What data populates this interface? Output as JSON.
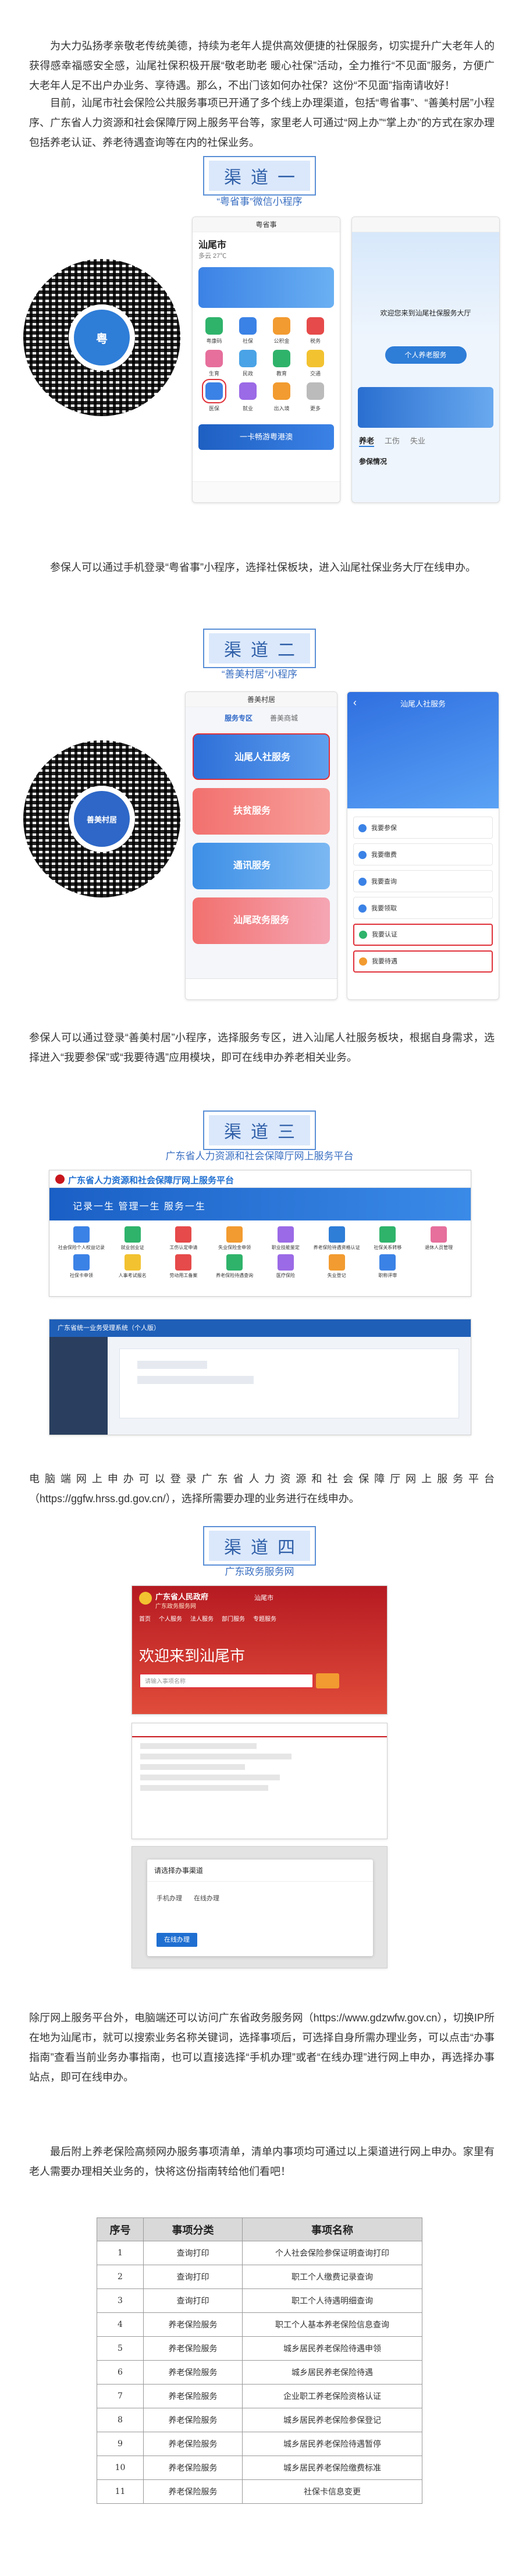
{
  "intro": {
    "p1": "为大力弘扬孝亲敬老传统美德，持续为老年人提供高效便捷的社保服务，切实提升广大老年人的获得感幸福感安全感，汕尾社保积极开展“敬老助老 暖心社保”活动，全力推行“不见面”服务，方便广大老年人足不出户办业务、享待遇。那么，不出门该如何办社保？这份“不见面”指南请收好！",
    "p2": "目前，汕尾市社会保险公共服务事项已开通了多个线上办理渠道，包括“粤省事”、“善美村居”小程序、广东省人力资源和社会保障厅网上服务平台等，家里老人可通过“网上办”“掌上办”的方式在家办理包括养老认证、养老待遇查询等在内的社保业务。"
  },
  "channels": [
    {
      "badge": "渠道一",
      "subtitle": "“粤省事”微信小程序",
      "qr_logo": "粤",
      "phone1": {
        "title": "粤省事",
        "city": "汕尾市",
        "weather": "多云 27℃",
        "icons": [
          "粤康码",
          "社保",
          "公积金",
          "税务",
          "生育",
          "民政",
          "教育",
          "交通",
          "医保",
          "就业",
          "出入境",
          "更多"
        ],
        "banner": "一卡畅游粤港澳"
      },
      "phone2": {
        "welcome": "欢迎您来到汕尾社保服务大厅",
        "btn": "个人养老服务",
        "tabs": [
          "养老",
          "工伤",
          "失业"
        ],
        "section": "参保情况"
      }
    },
    {
      "badge": "渠道二",
      "subtitle": "“善美村居”小程序",
      "qr_logo": "善美村居",
      "phone1": {
        "title": "善美村居",
        "tabs": [
          "服务专区",
          "善美商城"
        ],
        "cards": [
          "汕尾人社服务",
          "扶贫服务",
          "通讯服务",
          "汕尾政务服务"
        ]
      },
      "phone2": {
        "title": "汕尾人社服务",
        "items": [
          "我要参保",
          "我要缴费",
          "我要查询",
          "我要领取",
          "我要认证",
          "我要待遇"
        ]
      }
    },
    {
      "badge": "渠道三",
      "subtitle": "广东省人力资源和社会保障厅网上服务平台",
      "site_title": "广东省人力资源和社会保障厅网上服务平台",
      "slogan": "记录一生  管理一生  服务一生",
      "services": [
        "社会保险个人权益记录",
        "就业创业证",
        "工伤认定申请",
        "失业保险金申领",
        "职业技能鉴定",
        "养老保险待遇资格认证",
        "社保关系转移",
        "退休人员管理",
        "社保卡申领",
        "人事考试报名",
        "劳动用工备案",
        "养老保险待遇查询",
        "医疗保险",
        "失业登记",
        "职称评审"
      ],
      "panel_title": "广东省统一业务受理系统（个人版）"
    },
    {
      "badge": "渠道四",
      "subtitle": "广东政务服务网",
      "site_name": "广东省人民政府",
      "portal": "广东政务服务网",
      "location": "汕尾市",
      "welcome": "欢迎来到汕尾市",
      "nav": [
        "首页",
        "个人服务",
        "法人服务",
        "部门服务",
        "专题服务"
      ],
      "search_placeholder": "请输入事项名称",
      "dialog_title": "请选择办事渠道",
      "dialog_options": [
        "手机办理",
        "在线办理"
      ],
      "dialog_button": "在线办理"
    }
  ],
  "captions": {
    "c1": "参保人可以通过手机登录“粤省事”小程序，选择社保板块，进入汕尾社保业务大厅在线申办。",
    "c2": "参保人可以通过登录“善美村居”小程序，选择服务专区，进入汕尾人社服务板块，根据自身需求，选择进入“我要参保”或“我要待遇”应用模块，即可在线申办养老相关业务。",
    "c3": "电脑端网上申办可以登录广东省人力资源和社会保障厅网上服务平台（https://ggfw.hrss.gd.gov.cn/），选择所需要办理的业务进行在线申办。",
    "c4": "除厅网上服务平台外，电脑端还可以访问广东省政务服务网（https://www.gdzwfw.gov.cn），切换IP所在地为汕尾市，就可以搜索业务名称关键词，选择事项后，可选择自身所需办理业务，可以点击“办事指南”查看当前业务办事指南，也可以直接选择“手机办理”或者“在线办理”进行网上申办，再选择办事站点，即可在线申办。",
    "c5": "最后附上养老保险高频网办服务事项清单，清单内事项均可通过以上渠道进行网上申办。家里有老人需要办理相关业务的，快将这份指南转给他们看吧！"
  },
  "table": {
    "headers": [
      "序号",
      "事项分类",
      "事项名称"
    ],
    "rows": [
      [
        "1",
        "查询打印",
        "个人社会保险参保证明查询打印"
      ],
      [
        "2",
        "查询打印",
        "职工个人缴费记录查询"
      ],
      [
        "3",
        "查询打印",
        "职工个人待遇明细查询"
      ],
      [
        "4",
        "养老保险服务",
        "职工个人基本养老保险信息查询"
      ],
      [
        "5",
        "养老保险服务",
        "城乡居民养老保险待遇申领"
      ],
      [
        "6",
        "养老保险服务",
        "城乡居民养老保险待遇"
      ],
      [
        "7",
        "养老保险服务",
        "企业职工养老保险资格认证"
      ],
      [
        "8",
        "养老保险服务",
        "城乡居民养老保险参保登记"
      ],
      [
        "9",
        "养老保险服务",
        "城乡居民养老保险待遇暂停"
      ],
      [
        "10",
        "养老保险服务",
        "城乡居民养老保险缴费标准"
      ],
      [
        "11",
        "养老保险服务",
        "社保卡信息变更"
      ]
    ]
  },
  "colors": {
    "badge_border": "#5a8fd6",
    "badge_fill": "#dbe8fb",
    "site_blue": "#1f6fd1",
    "gov_red": "#c8161d",
    "highlight": "#e0313a"
  }
}
